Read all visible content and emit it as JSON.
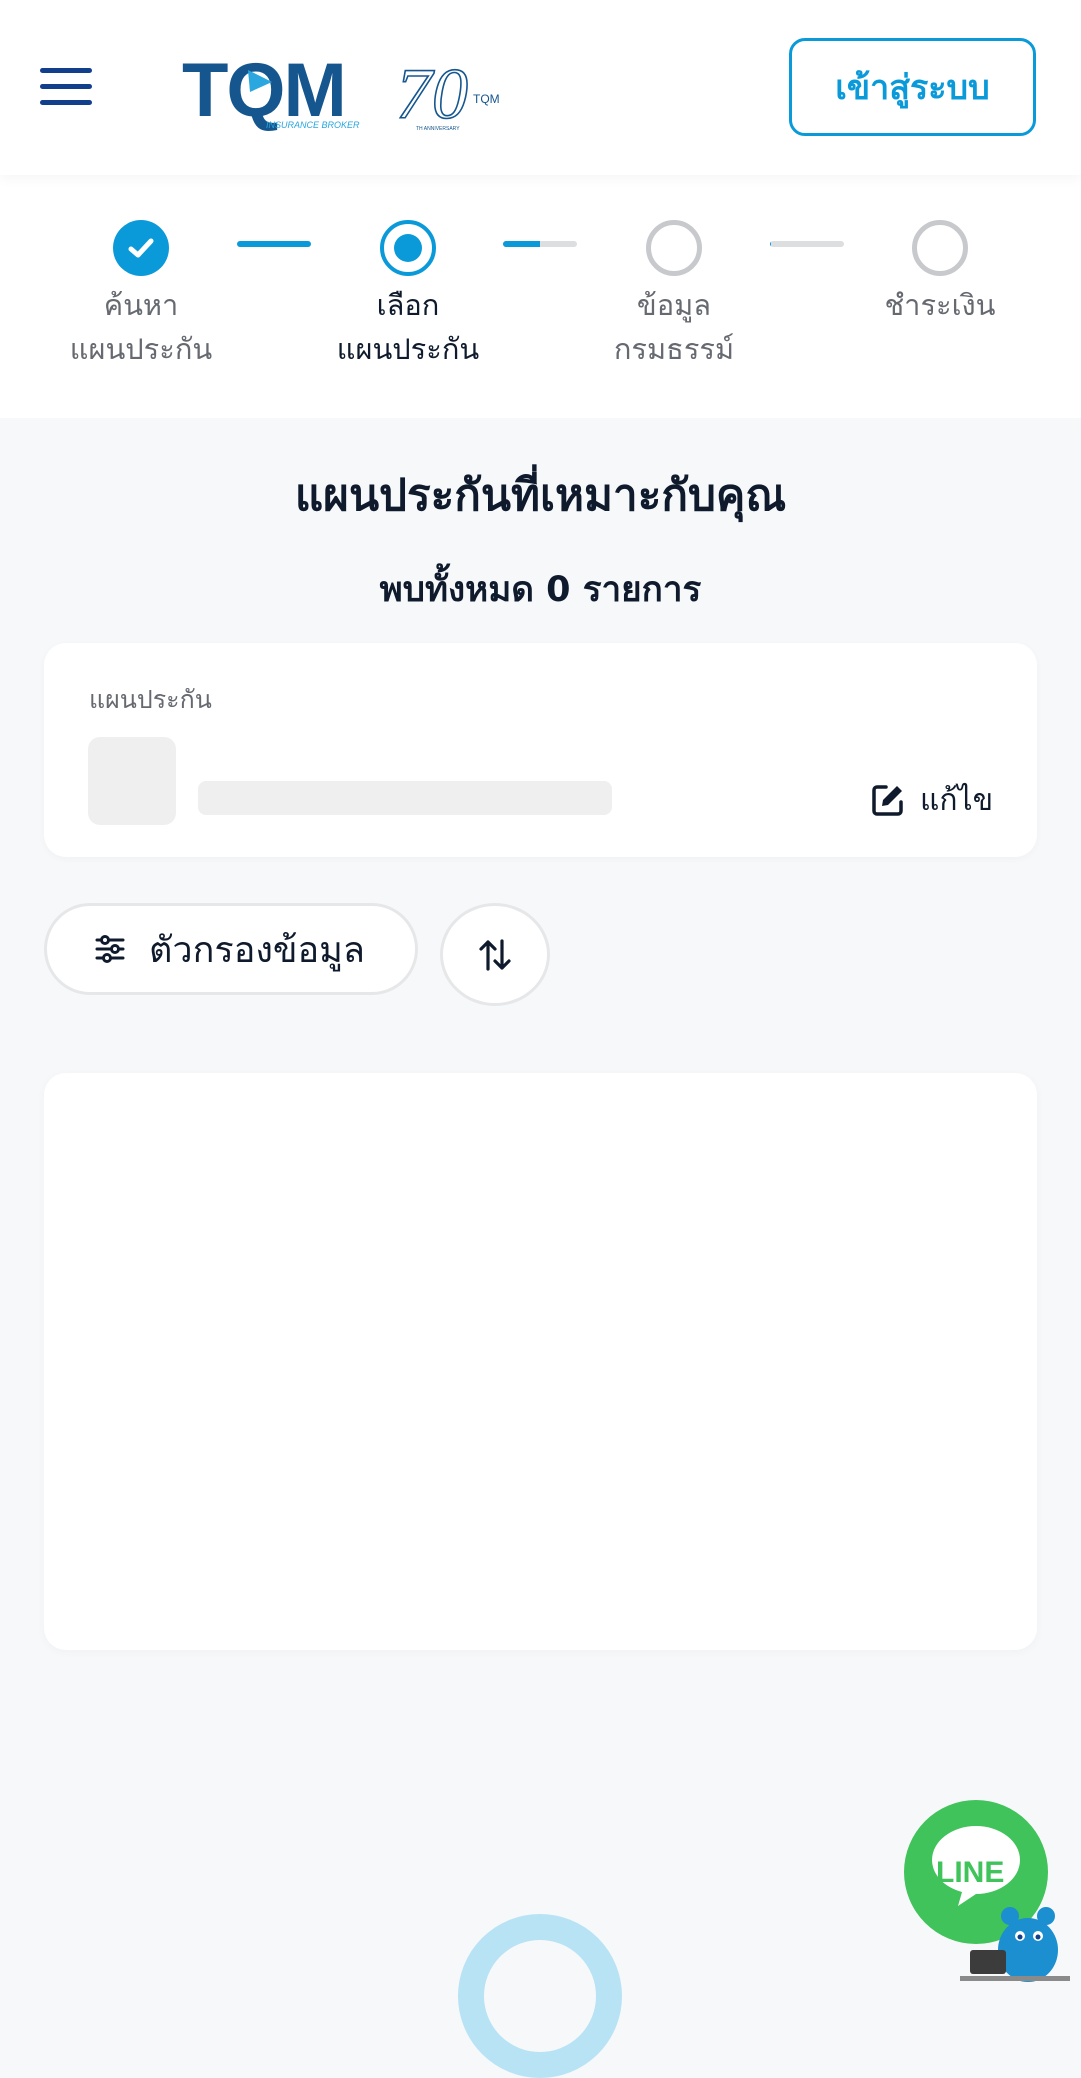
{
  "header": {
    "logo_text": "TQM",
    "logo_subtext": "INSURANCE BROKER",
    "anniversary_text": "70",
    "anniversary_brand": "TQM",
    "anniversary_subtext": "TH ANNIVERSARY",
    "login_label": "เข้าสู่ระบบ"
  },
  "stepper": {
    "steps": [
      {
        "line1": "ค้นหา",
        "line2": "แผนประกัน",
        "state": "done"
      },
      {
        "line1": "เลือก",
        "line2": "แผนประกัน",
        "state": "current"
      },
      {
        "line1": "ข้อมูล",
        "line2": "กรมธรรม์",
        "state": "todo"
      },
      {
        "line1": "ชำระเงิน",
        "line2": "",
        "state": "todo"
      }
    ],
    "connector_progress": [
      1.0,
      0.5,
      0.02
    ]
  },
  "main": {
    "title": "แผนประกันที่เหมาะกับคุณ",
    "result_count": "พบทั้งหมด 0 รายการ",
    "plan_card": {
      "label": "แผนประกัน",
      "edit_label": "แก้ไข"
    },
    "filter_label": "ตัวกรองข้อมูล"
  },
  "line_widget": {
    "label": "LINE"
  },
  "colors": {
    "primary": "#0b9ad9",
    "navy": "#123f8c",
    "line_green": "#3fc35a",
    "background": "#f7f8fa"
  },
  "icons": [
    "hamburger-menu-icon",
    "check-icon",
    "edit-icon",
    "filter-sliders-icon",
    "sort-arrows-icon",
    "line-chat-icon"
  ]
}
